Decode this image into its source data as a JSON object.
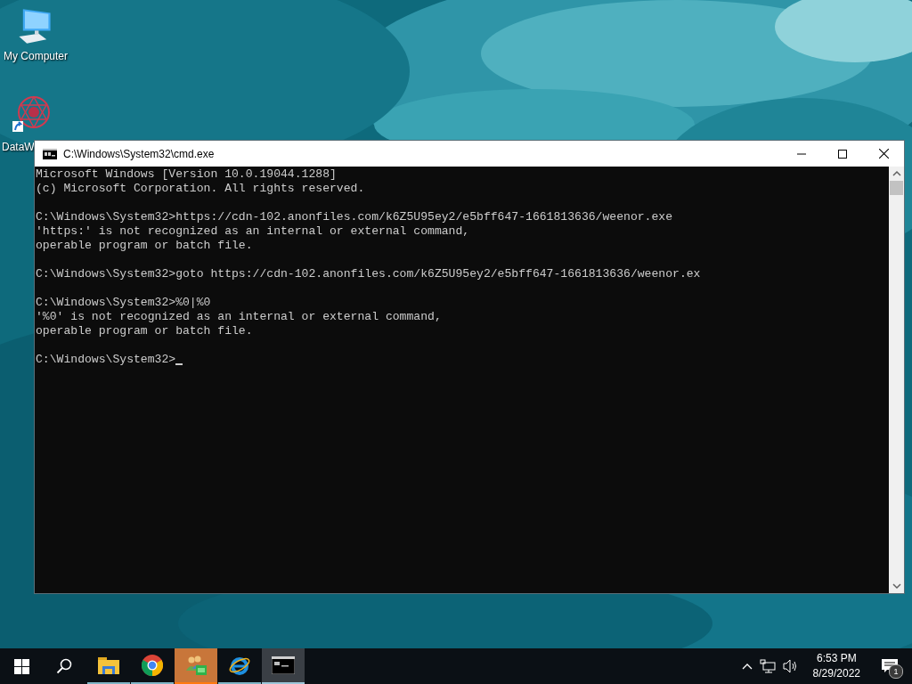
{
  "desktop_icons": [
    {
      "label": "My Computer",
      "kind": "computer"
    },
    {
      "label": "DataW",
      "kind": "network"
    }
  ],
  "window": {
    "title": "C:\\Windows\\System32\\cmd.exe",
    "console_blocks": [
      [
        "Microsoft Windows [Version 10.0.19044.1288]",
        "(c) Microsoft Corporation. All rights reserved."
      ],
      [
        "C:\\Windows\\System32>https://cdn-102.anonfiles.com/k6Z5U95ey2/e5bff647-1661813636/weenor.exe",
        "'https:' is not recognized as an internal or external command,",
        "operable program or batch file."
      ],
      [
        "C:\\Windows\\System32>goto https://cdn-102.anonfiles.com/k6Z5U95ey2/e5bff647-1661813636/weenor.ex"
      ],
      [
        "C:\\Windows\\System32>%0|%0",
        "'%0' is not recognized as an internal or external command,",
        "operable program or batch file."
      ],
      [
        "C:\\Windows\\System32>"
      ]
    ],
    "cursor": true
  },
  "taskbar": {
    "apps": [
      {
        "kind": "explorer",
        "selected": false,
        "flashing": false
      },
      {
        "kind": "chrome",
        "selected": false,
        "flashing": false
      },
      {
        "kind": "users",
        "selected": false,
        "flashing": true
      },
      {
        "kind": "ie",
        "selected": false,
        "flashing": false
      },
      {
        "kind": "cmd",
        "selected": true,
        "flashing": false
      }
    ],
    "time": "6:53 PM",
    "date": "8/29/2022",
    "notification_count": "1"
  }
}
